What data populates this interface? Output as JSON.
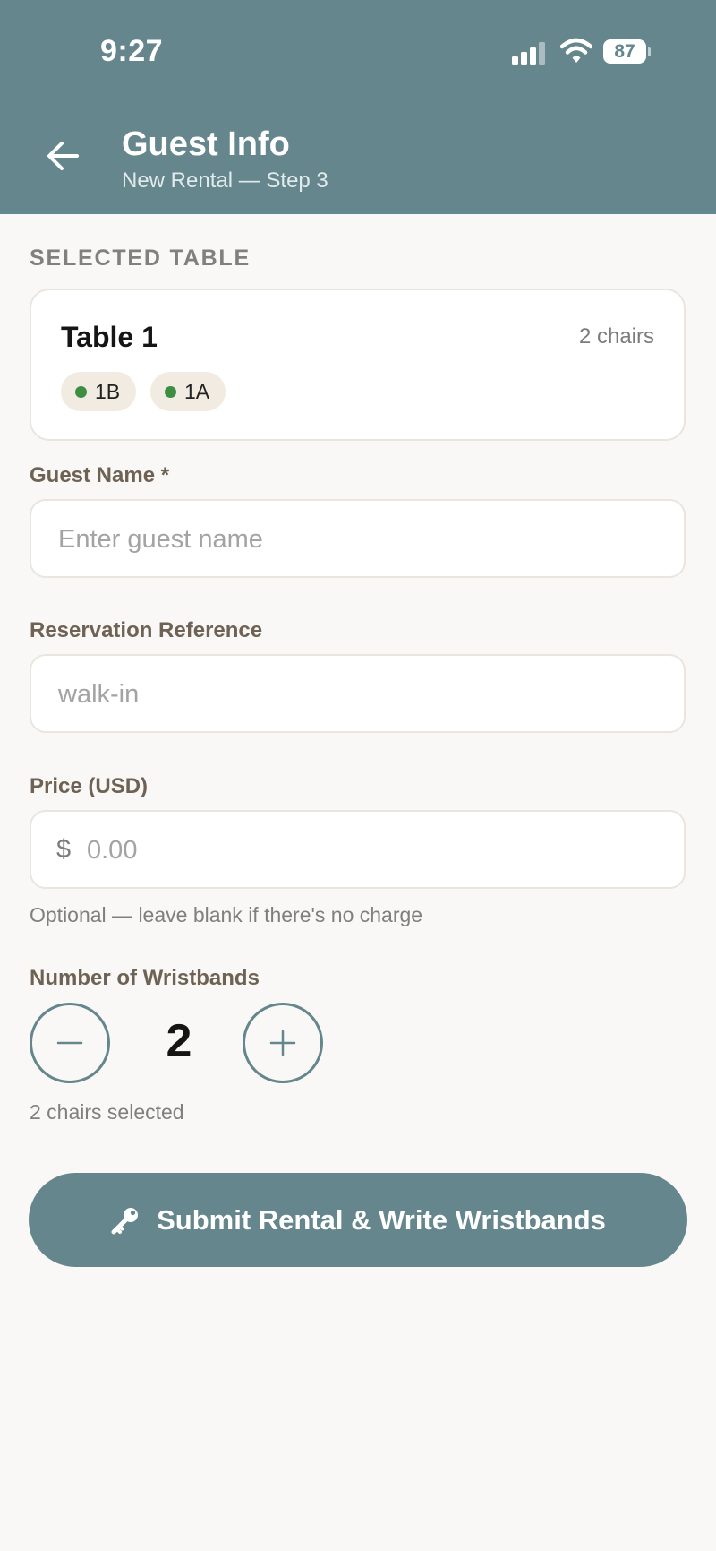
{
  "status_bar": {
    "time": "9:27",
    "battery": "87"
  },
  "header": {
    "title": "Guest Info",
    "subtitle": "New Rental — Step 3"
  },
  "selected_table": {
    "section_label": "SELECTED TABLE",
    "name": "Table 1",
    "chairs": "2 chairs",
    "seats": [
      {
        "label": "1B",
        "status_color": "#3e8e41"
      },
      {
        "label": "1A",
        "status_color": "#3e8e41"
      }
    ]
  },
  "form": {
    "guest_name": {
      "label": "Guest Name *",
      "placeholder": "Enter guest name",
      "value": ""
    },
    "reservation": {
      "label": "Reservation Reference",
      "placeholder": "walk-in",
      "value": ""
    },
    "price": {
      "label": "Price (USD)",
      "currency": "$",
      "placeholder": "0.00",
      "value": "",
      "help": "Optional — leave blank if there's no charge"
    },
    "wristbands": {
      "label": "Number of Wristbands",
      "value": "2",
      "help": "2 chairs selected"
    }
  },
  "submit": {
    "label": "Submit Rental & Write Wristbands",
    "icon": "key-icon"
  },
  "colors": {
    "accent": "#64868c",
    "background": "#f9f8f6",
    "seat_available": "#3e8e41"
  }
}
